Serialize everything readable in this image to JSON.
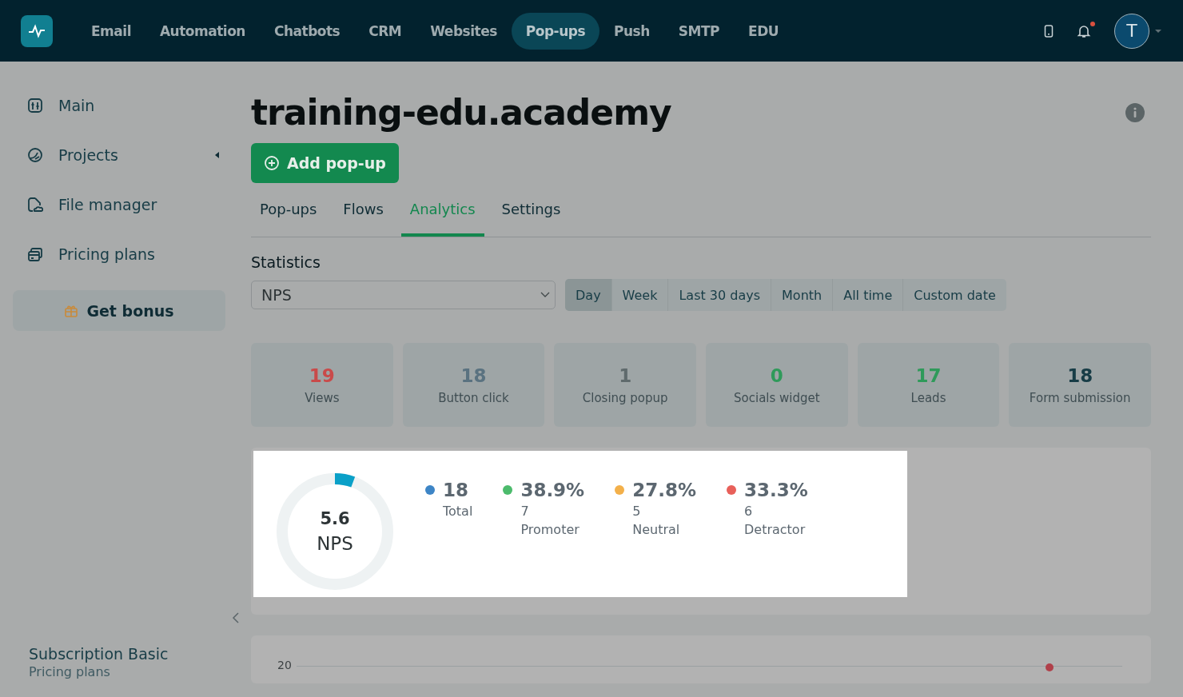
{
  "nav": {
    "items": [
      {
        "label": "Email",
        "selected": false
      },
      {
        "label": "Automation",
        "selected": false
      },
      {
        "label": "Chatbots",
        "selected": false
      },
      {
        "label": "CRM",
        "selected": false
      },
      {
        "label": "Websites",
        "selected": false
      },
      {
        "label": "Pop-ups",
        "selected": true
      },
      {
        "label": "Push",
        "selected": false
      },
      {
        "label": "SMTP",
        "selected": false
      },
      {
        "label": "EDU",
        "selected": false
      }
    ],
    "notification_unread": true,
    "avatar_initial": "T"
  },
  "sidebar": {
    "items": [
      {
        "label": "Main",
        "expandable": false
      },
      {
        "label": "Projects",
        "expandable": true
      },
      {
        "label": "File manager",
        "expandable": false
      },
      {
        "label": "Pricing plans",
        "expandable": false
      }
    ],
    "bonus_button": "Get bonus",
    "subscription": "Subscription Basic",
    "subscription_link": "Pricing plans"
  },
  "page": {
    "title": "training-edu.academy",
    "add_button": "Add pop-up",
    "tabs": [
      {
        "label": "Pop-ups",
        "selected": false
      },
      {
        "label": "Flows",
        "selected": false
      },
      {
        "label": "Analytics",
        "selected": true
      },
      {
        "label": "Settings",
        "selected": false
      }
    ],
    "statistics_label": "Statistics",
    "statistics_select": "NPS",
    "periods": [
      {
        "label": "Day",
        "selected": true
      },
      {
        "label": "Week",
        "selected": false
      },
      {
        "label": "Last 30 days",
        "selected": false
      },
      {
        "label": "Month",
        "selected": false
      },
      {
        "label": "All time",
        "selected": false
      },
      {
        "label": "Custom date",
        "selected": false
      }
    ],
    "stats": [
      {
        "value": "19",
        "label": "Views",
        "color": "#c94a4a"
      },
      {
        "value": "18",
        "label": "Button click",
        "color": "#5a7280"
      },
      {
        "value": "1",
        "label": "Closing popup",
        "color": "#5f6a6c"
      },
      {
        "value": "0",
        "label": "Socials widget",
        "color": "#2f9a5a"
      },
      {
        "value": "17",
        "label": "Leads",
        "color": "#2f9a5a"
      },
      {
        "value": "18",
        "label": "Form submission",
        "color": "#173c46"
      }
    ],
    "nps": {
      "score": "5.6",
      "label": "NPS",
      "level": 0.056,
      "metrics": [
        {
          "value": "18",
          "label": "Total",
          "color": "#3d85c6"
        },
        {
          "value": "38.9%",
          "count": "7",
          "label": "Promoter",
          "color": "#4cbb6c"
        },
        {
          "value": "27.8%",
          "count": "5",
          "label": "Neutral",
          "color": "#f3b04a"
        },
        {
          "value": "33.3%",
          "count": "6",
          "label": "Detractor",
          "color": "#e8605a"
        }
      ]
    },
    "chart_top_tick": "20"
  }
}
